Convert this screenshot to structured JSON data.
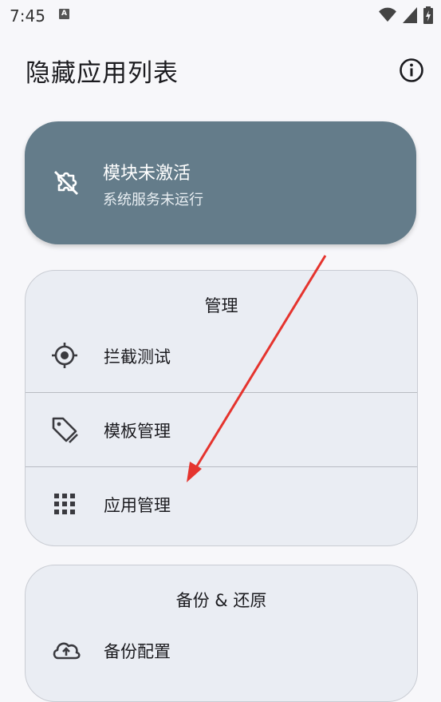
{
  "status_bar": {
    "time": "7:45",
    "notification_glyph": "A",
    "icons": [
      "wifi-icon",
      "signal-icon",
      "battery-charging-icon"
    ]
  },
  "app_bar": {
    "title": "隐藏应用列表",
    "action_icon": "info-icon"
  },
  "status_card": {
    "icon": "extension-off-icon",
    "title": "模块未激活",
    "subtitle": "系统服务未运行",
    "background_color": "#647c8a"
  },
  "manage_group": {
    "title": "管理",
    "items": [
      {
        "label": "拦截测试",
        "icon": "target-icon"
      },
      {
        "label": "模板管理",
        "icon": "tag-icon"
      },
      {
        "label": "应用管理",
        "icon": "apps-grid-icon"
      }
    ]
  },
  "backup_group": {
    "title": "备份 & 还原",
    "items": [
      {
        "label": "备份配置",
        "icon": "cloud-upload-icon"
      }
    ]
  },
  "annotation": {
    "color": "#e5342e",
    "points_to": "应用管理"
  }
}
